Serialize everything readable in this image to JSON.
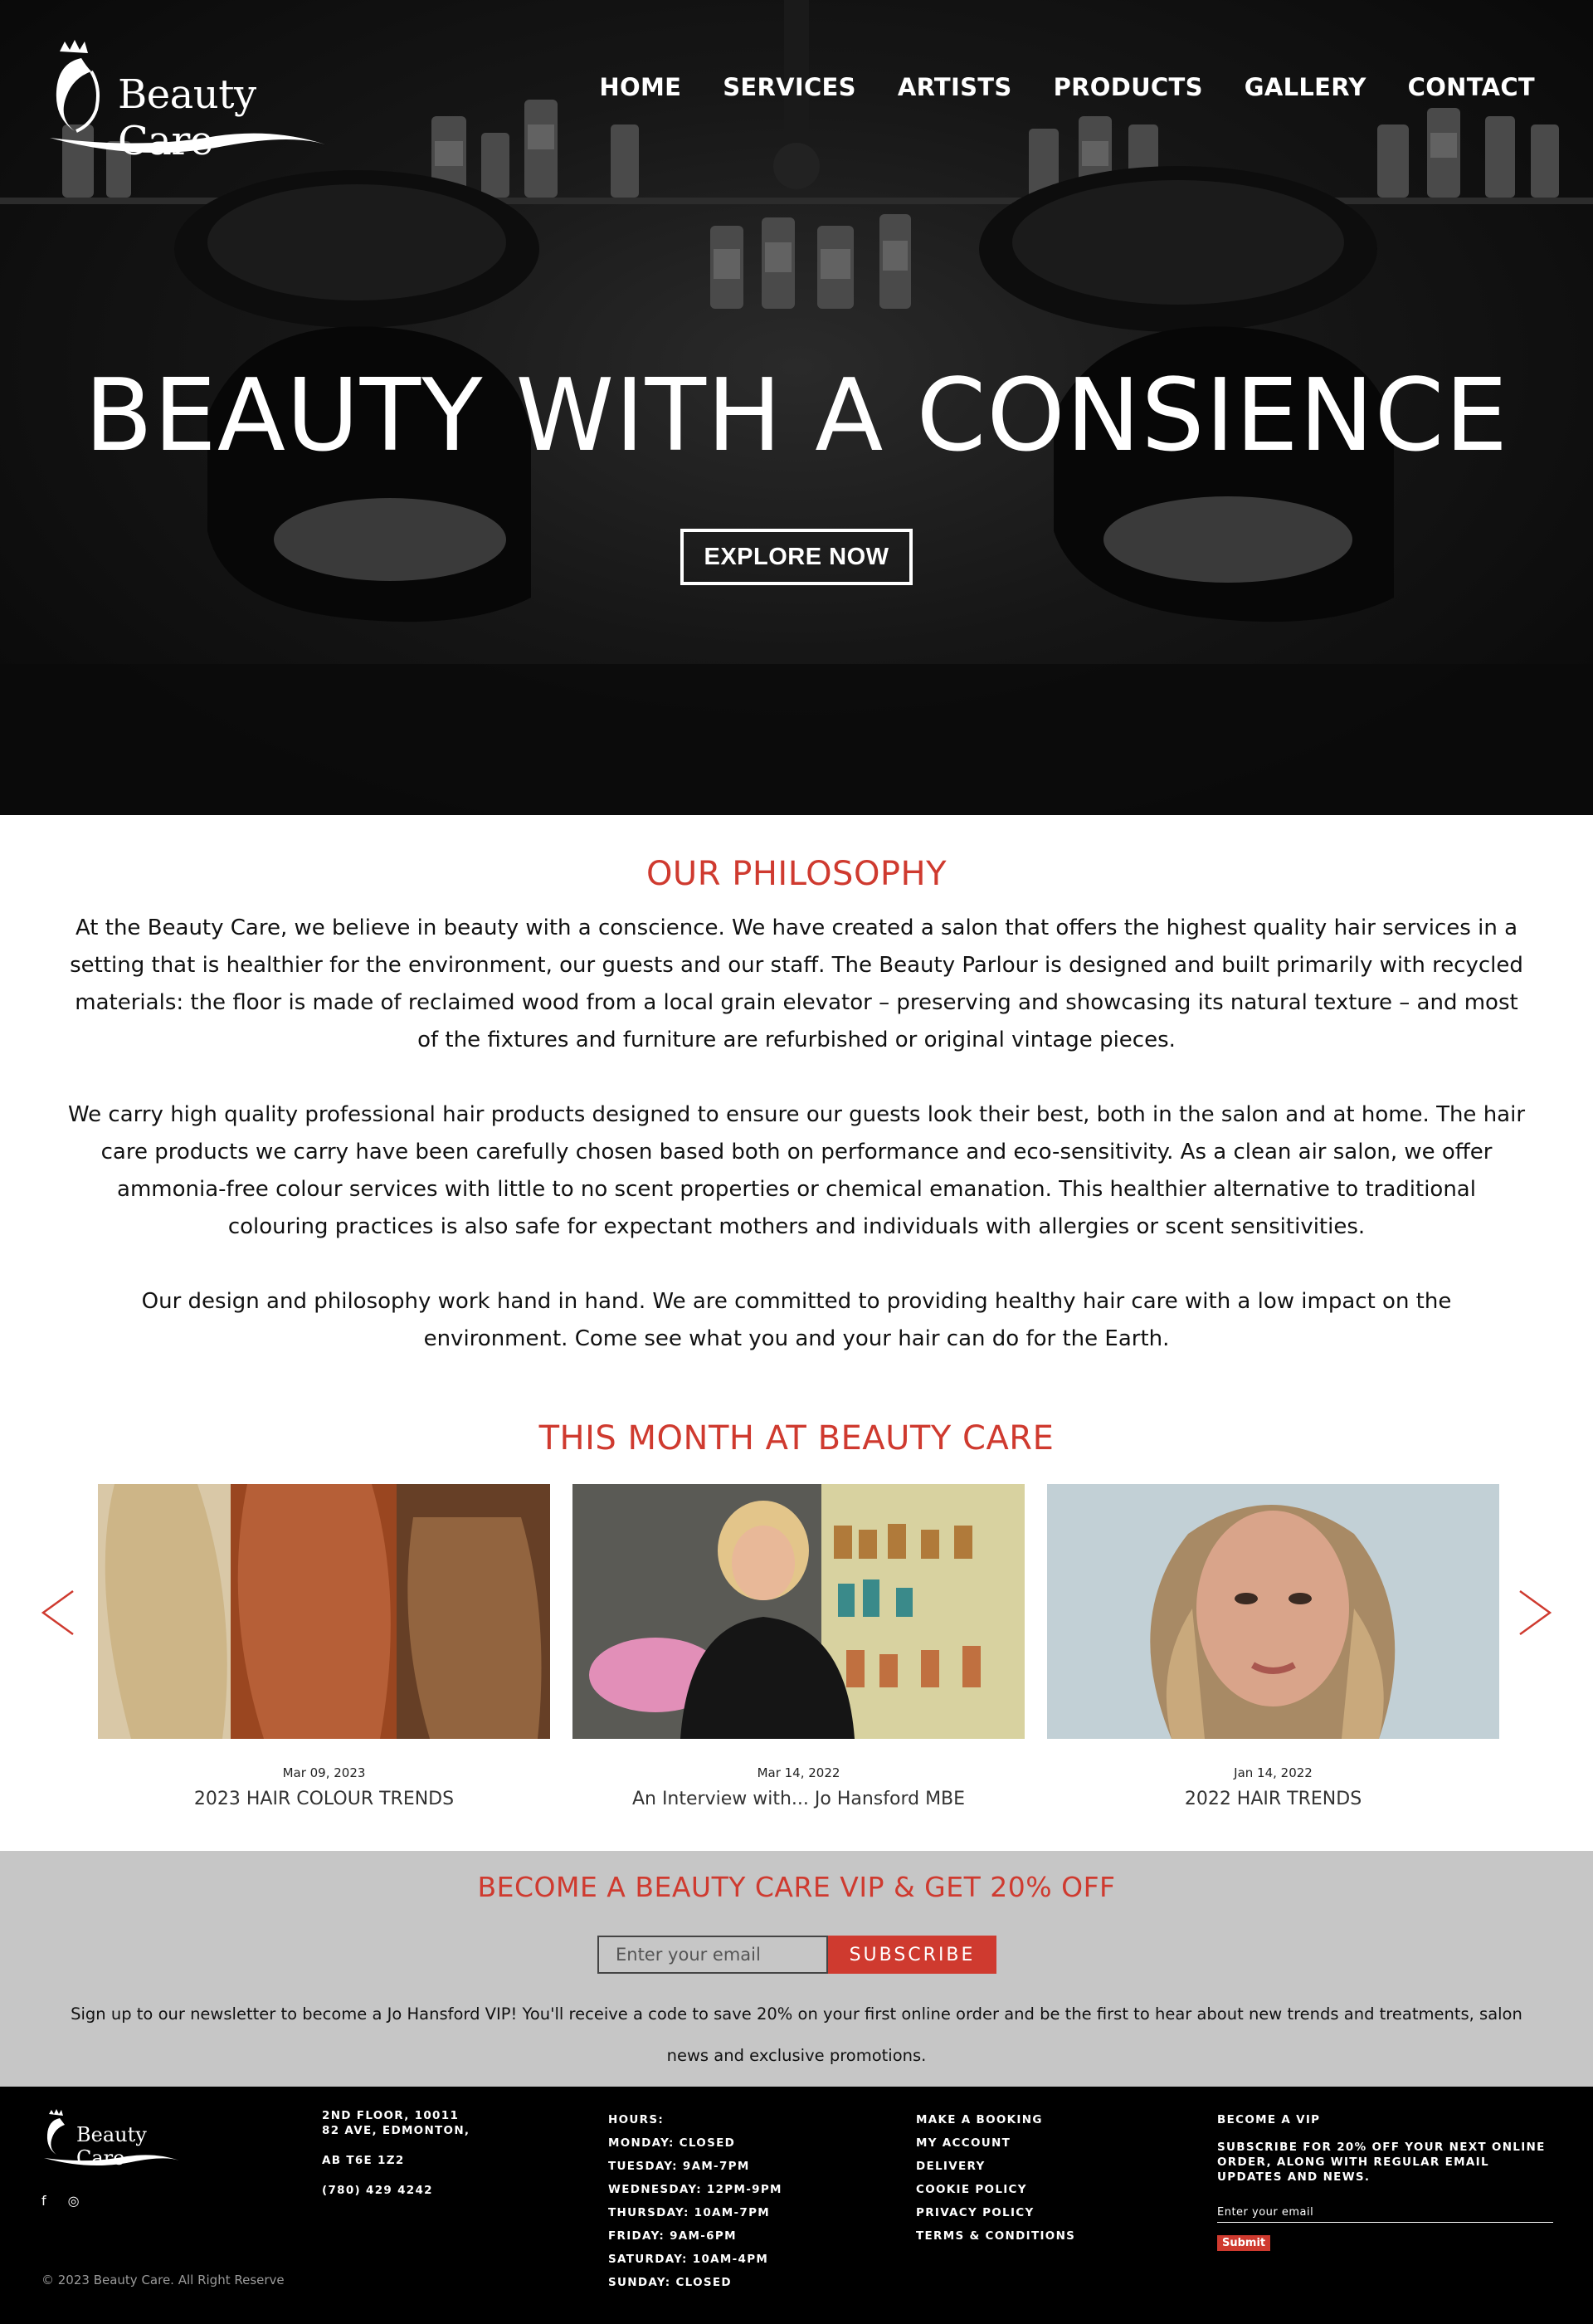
{
  "brand": {
    "name": "Beauty Care"
  },
  "nav": {
    "items": [
      "HOME",
      "SERVICES",
      "ARTISTS",
      "PRODUCTS",
      "GALLERY",
      "CONTACT"
    ]
  },
  "hero": {
    "title": "BEAUTY WITH A CONSIENCE",
    "button": "EXPLORE NOW"
  },
  "philosophy": {
    "title": "OUR PHILOSOPHY",
    "paragraphs": [
      "At the Beauty Care, we believe in beauty with a conscience. We have created a salon that offers the highest quality hair services in a setting that is healthier for the environment, our guests and our staff. The Beauty Parlour is designed and built primarily with recycled materials: the floor is made of reclaimed wood from a local grain elevator – preserving and showcasing its natural texture – and most of the fixtures and furniture are refurbished or original vintage pieces.",
      "We carry high quality professional hair products designed to ensure our guests look their best, both in the salon and at home. The hair care products we carry have been carefully chosen based both on performance and eco-sensitivity. As a clean air salon, we offer ammonia-free colour services with little to no scent properties or chemical emanation. This healthier alternative to traditional colouring practices is also safe for expectant mothers and individuals with allergies or scent sensitivities.",
      "Our design and philosophy work hand in hand. We are committed to providing healthy hair care with a low impact on the environment. Come see what you and your hair can do for the Earth."
    ]
  },
  "month": {
    "title": "THIS MONTH AT BEAUTY CARE",
    "cards": [
      {
        "date": "Mar 09, 2023",
        "title": "2023 HAIR COLOUR TRENDS"
      },
      {
        "date": "Mar 14, 2022",
        "title": "An Interview with... Jo Hansford MBE"
      },
      {
        "date": "Jan 14, 2022",
        "title": "2022 HAIR TRENDS"
      }
    ]
  },
  "vip": {
    "title": "BECOME A BEAUTY CARE VIP & GET 20% OFF",
    "placeholder": "Enter your email",
    "button": "SUBSCRIBE",
    "text": "Sign up to our newsletter to become a Jo Hansford VIP! You'll receive a code to save 20% on your first online order and be the first to hear about new trends and treatments, salon news and exclusive promotions."
  },
  "footer": {
    "address": [
      "2ND FLOOR, 10011",
      "82 AVE, EDMONTON,",
      "AB T6E 1Z2",
      "(780) 429 4242"
    ],
    "hours": [
      "HOURS:",
      "MONDAY: CLOSED",
      "TUESDAY: 9AM-7PM",
      "WEDNESDAY: 12PM-9PM",
      "THURSDAY: 10AM-7PM",
      "FRIDAY: 9AM-6PM",
      "SATURDAY: 10AM-4PM",
      "SUNDAY: CLOSED"
    ],
    "links": [
      "MAKE A BOOKING",
      "MY ACCOUNT",
      "DELIVERY",
      "COOKIE POLICY",
      "PRIVACY POLICY",
      "TERMS & CONDITIONS"
    ],
    "vip_title": "BECOME A VIP",
    "vip_desc": "SUBSCRIBE FOR 20% OFF YOUR NEXT ONLINE ORDER, ALONG WITH REGULAR EMAIL UPDATES AND NEWS.",
    "vip_placeholder": "Enter your email",
    "vip_button": "Submit",
    "social": [
      "f",
      "◎"
    ],
    "copyright": "© 2023 Beauty Care. All Right Reserve"
  },
  "colors": {
    "accent": "#cf3a2f",
    "vip_bg": "#c6c6c6",
    "footer_bg": "#000000"
  }
}
